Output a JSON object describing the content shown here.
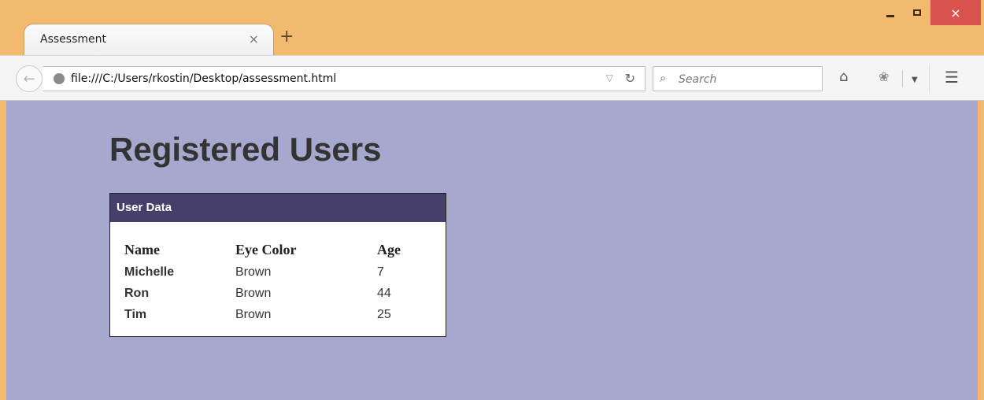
{
  "browser": {
    "tab_title": "Assessment",
    "tab_close": "×",
    "new_tab": "+",
    "url": "file:///C:/Users/rkostin/Desktop/assessment.html",
    "search_placeholder": "Search",
    "window_close": "×"
  },
  "page": {
    "title": "Registered Users",
    "panel_heading": "User Data",
    "table": {
      "headers": [
        "Name",
        "Eye Color",
        "Age"
      ],
      "rows": [
        {
          "name": "Michelle",
          "eye_color": "Brown",
          "age": "7"
        },
        {
          "name": "Ron",
          "eye_color": "Brown",
          "age": "44"
        },
        {
          "name": "Tim",
          "eye_color": "Brown",
          "age": "25"
        }
      ]
    }
  },
  "colors": {
    "titlebar": "#f3b96f",
    "page_background": "#a6a8cd",
    "panel_header": "#463f6a",
    "close_button": "#d9534f"
  }
}
